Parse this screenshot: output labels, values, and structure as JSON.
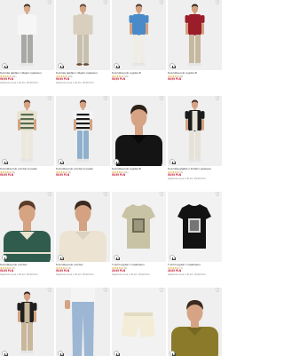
{
  "grid": {
    "cards": [
      {
        "name": "Koszula gładka z długim rękawem",
        "stars": "★★★★★",
        "reviews": "(51)",
        "price": "99,99 PLN",
        "old_price": "Najniższa cena z 30 dni: 99,99 PLN",
        "bg": "#efefef",
        "top": "#f6f6f6",
        "top2": "#e4e4e4",
        "pants": "#a8a9a5",
        "skin": "#d9a988",
        "hair": "#3b2a20",
        "shoes": "#e8e8e8",
        "style": "shirt"
      },
      {
        "name": "Koszula gładka z długim rękawem",
        "stars": "★★★★★",
        "reviews": "(24)",
        "price": "99,99 PLN",
        "old_price": "Najniższa cena z 30 dni: 99,99 PLN",
        "bg": "#efefef",
        "top": "#d9cfbf",
        "top2": "#c9bda9",
        "pants": "#c9bfae",
        "skin": "#d4a382",
        "hair": "#5a4332",
        "shoes": "#6b4a34",
        "style": "shirt"
      },
      {
        "name": "Koszulka polo regular fit",
        "stars": "★★★★★",
        "reviews": "(13)",
        "price": "59,99 PLN",
        "old_price": "",
        "bg": "#efefef",
        "top": "#4a8ac8",
        "top2": "#3a76b2",
        "pants": "#f0ede6",
        "skin": "#d5a080",
        "hair": "#4a3424",
        "shoes": "#e8e8e8",
        "style": "polo"
      },
      {
        "name": "Koszulka polo regular fit",
        "stars": "★★★★★",
        "reviews": "(8)",
        "price": "59,99 PLN",
        "old_price": "",
        "bg": "#efefef",
        "top": "#9b1d2a",
        "top2": "#861624",
        "pants": "#c7b8a0",
        "skin": "#d3a07f",
        "hair": "#2e211a",
        "shoes": "#e8e8e8",
        "style": "polo"
      },
      {
        "name": "Koszulka polo comfort w paski",
        "stars": "★★★★★",
        "reviews": "(5)",
        "price": "59,99 PLN",
        "old_price": "",
        "bg": "#efefef",
        "top": "#e8e2cf",
        "top2": "#556b4f",
        "pants": "#ece8de",
        "skin": "#d5a382",
        "hair": "#4a3424",
        "shoes": "#e8e8e8",
        "style": "stripe"
      },
      {
        "name": "Koszulka polo comfort w paski",
        "stars": "★★★★★",
        "reviews": "(3)",
        "price": "59,99 PLN",
        "old_price": "",
        "bg": "#efefef",
        "top": "#f4f4f4",
        "top2": "#1a1a1a",
        "pants": "#8fb0cc",
        "skin": "#d4a283",
        "hair": "#3b2a20",
        "shoes": "#e8e8e8",
        "style": "stripe"
      },
      {
        "name": "Koszulka polo regular fit",
        "stars": "★★★★★",
        "reviews": "(21)",
        "price": "59,99 PLN",
        "old_price": "",
        "bg": "#efefef",
        "top": "#141414",
        "top2": "#0a0a0a",
        "pants": "#141414",
        "skin": "#d6a485",
        "hair": "#2e211a",
        "shoes": "#e8e8e8",
        "style": "closeup"
      },
      {
        "name": "Koszulka gładka z krótkim rękawem",
        "stars": "★★★★★",
        "reviews": "(2)",
        "price": "59,99 PLN",
        "old_price": "Najniższa cena z 30 dni: 59,99 PLN",
        "bg": "#efefef",
        "top": "#1c1c1c",
        "top2": "#e6e2d8",
        "pants": "#e6e2d8",
        "skin": "#d5a383",
        "hair": "#3b2a20",
        "shoes": "#e8e8e8",
        "style": "overshirt"
      },
      {
        "name": "Koszulka polo comfort",
        "stars": "★★★★★",
        "reviews": "(6)",
        "price": "59,99 PLN",
        "old_price": "Najniższa cena z 30 dni: 59,99 PLN",
        "bg": "#efefef",
        "top": "#2f5c4c",
        "top2": "#e8e2cf",
        "pants": "#2f5c4c",
        "skin": "#d6a383",
        "hair": "#5a3c28",
        "shoes": "#e8e8e8",
        "style": "closeup"
      },
      {
        "name": "Koszulka polo comfort",
        "stars": "★★★★★",
        "reviews": "(4)",
        "price": "59,99 PLN",
        "old_price": "Najniższa cena z 30 dni: 59,99 PLN",
        "bg": "#efefef",
        "top": "#ece3d2",
        "top2": "#ddd2bf",
        "pants": "#ece3d2",
        "skin": "#d4a282",
        "hair": "#3b2a20",
        "shoes": "#e8e8e8",
        "style": "closeup"
      },
      {
        "name": "T-shirt regular z nadrukiem",
        "stars": "★★★★★",
        "reviews": "(9)",
        "price": "39,99 PLN",
        "old_price": "Najniższa cena z 30 dni: 39,99 PLN",
        "bg": "#f2f2f2",
        "top": "#c9c3a6",
        "top2": "#6b6a55",
        "pants": "",
        "skin": "",
        "hair": "",
        "shoes": "",
        "style": "flat"
      },
      {
        "name": "T-shirt regular z nadrukiem",
        "stars": "★★★★★",
        "reviews": "(7)",
        "price": "39,99 PLN",
        "old_price": "Najniższa cena z 30 dni: 39,99 PLN",
        "bg": "#f2f2f2",
        "top": "#121212",
        "top2": "#d8d8d8",
        "pants": "",
        "skin": "",
        "hair": "",
        "shoes": "",
        "style": "flat"
      },
      {
        "name": "",
        "stars": "",
        "reviews": "",
        "price": "",
        "old_price": "",
        "bg": "#efefef",
        "top": "#1f1f1f",
        "top2": "#c9b79a",
        "pants": "#c9b79a",
        "skin": "#d5a383",
        "hair": "#2e211a",
        "shoes": "#e8e8e8",
        "style": "overshirt"
      },
      {
        "name": "",
        "stars": "",
        "reviews": "",
        "price": "",
        "old_price": "",
        "bg": "#efefef",
        "top": "#f4f4f4",
        "top2": "#f4f4f4",
        "pants": "#9cb6d4",
        "skin": "#d5a383",
        "hair": "",
        "shoes": "",
        "style": "pants"
      },
      {
        "name": "",
        "stars": "",
        "reviews": "",
        "price": "",
        "old_price": "",
        "bg": "#f2f2f2",
        "top": "#f3ecd6",
        "top2": "#e3dbc3",
        "pants": "",
        "skin": "",
        "hair": "",
        "shoes": "",
        "style": "shorts"
      },
      {
        "name": "",
        "stars": "",
        "reviews": "",
        "price": "",
        "old_price": "",
        "bg": "#efefef",
        "top": "#8a7a2a",
        "top2": "#766822",
        "pants": "#8a7a2a",
        "skin": "#d6a484",
        "hair": "#3b2a20",
        "shoes": "#e8e8e8",
        "style": "portrait"
      }
    ],
    "icons": {
      "favorite": "heart-icon",
      "add_to_cart": "shopping-bag-icon"
    }
  }
}
